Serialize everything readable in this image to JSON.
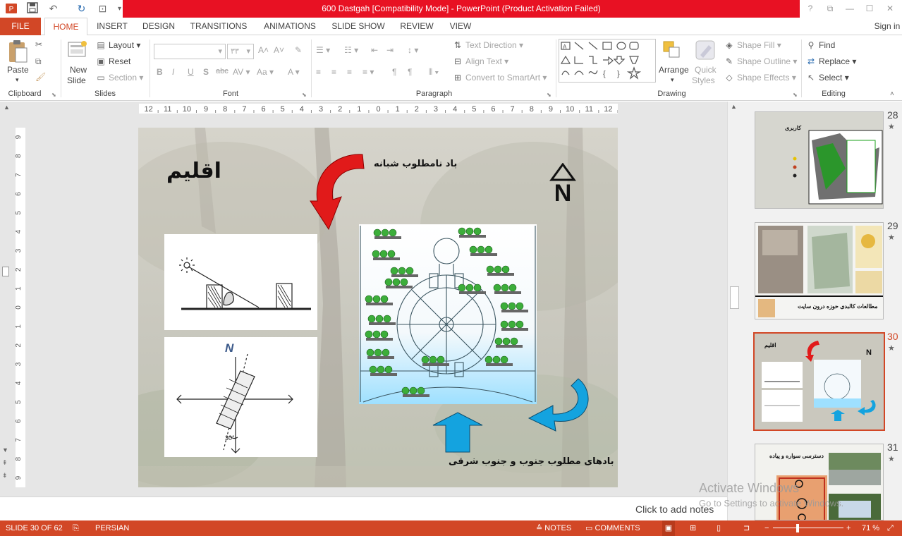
{
  "window": {
    "title": "600 Dastgah [Compatibility Mode] -  PowerPoint (Product Activation Failed)",
    "sign_in": "Sign in",
    "controls": [
      "?",
      "⧉",
      "—",
      "☐",
      "✕"
    ]
  },
  "tabs": [
    {
      "label": "FILE"
    },
    {
      "label": "HOME"
    },
    {
      "label": "INSERT"
    },
    {
      "label": "DESIGN"
    },
    {
      "label": "TRANSITIONS"
    },
    {
      "label": "ANIMATIONS"
    },
    {
      "label": "SLIDE SHOW"
    },
    {
      "label": "REVIEW"
    },
    {
      "label": "VIEW"
    }
  ],
  "ribbon": {
    "clipboard": {
      "label": "Clipboard",
      "paste": "Paste"
    },
    "slides": {
      "label": "Slides",
      "new_slide_1": "New",
      "new_slide_2": "Slide",
      "layout": "Layout",
      "reset": "Reset",
      "section": "Section"
    },
    "font": {
      "label": "Font",
      "size_value": "۳۳",
      "bold": "B",
      "italic": "I",
      "underline": "U",
      "shadow": "S",
      "strike": "abc",
      "spacing": "AV",
      "case": "Aa",
      "color": "A"
    },
    "paragraph": {
      "label": "Paragraph",
      "text_direction": "Text Direction",
      "align_text": "Align Text",
      "convert_smartart": "Convert to SmartArt"
    },
    "drawing": {
      "label": "Drawing",
      "arrange": "Arrange",
      "quick_styles_1": "Quick",
      "quick_styles_2": "Styles",
      "shape_fill": "Shape Fill",
      "shape_outline": "Shape Outline",
      "shape_effects": "Shape Effects"
    },
    "editing": {
      "label": "Editing",
      "find": "Find",
      "replace": "Replace",
      "select": "Select"
    }
  },
  "ruler": {
    "h_ticks": [
      "12",
      "11",
      "10",
      "9",
      "8",
      "7",
      "6",
      "5",
      "4",
      "3",
      "2",
      "1",
      "0",
      "1",
      "2",
      "3",
      "4",
      "5",
      "6",
      "7",
      "8",
      "9",
      "10",
      "11",
      "12"
    ],
    "v_ticks": [
      "9",
      "8",
      "7",
      "6",
      "5",
      "4",
      "3",
      "2",
      "1",
      "0",
      "1",
      "2",
      "3",
      "4",
      "5",
      "6",
      "7",
      "8",
      "9"
    ]
  },
  "slide": {
    "title": "اقلیم",
    "wind_bad": "باد نامطلوب شبانه",
    "wind_good": "بادهای مطلوب جنوب  و جنوب شرقی",
    "north": "N",
    "compass_north": "N",
    "angle": "30°"
  },
  "notes_placeholder": "Click to add notes",
  "thumbnails": [
    {
      "num": "28",
      "caption": "کاربری"
    },
    {
      "num": "29",
      "caption": "مطالعات کالبدی حوزه درون سایت"
    },
    {
      "num": "30",
      "caption": "اقلیم"
    },
    {
      "num": "31",
      "caption": "دسترسی سواره و پیاده"
    }
  ],
  "watermark": {
    "line1": "Activate Windows",
    "line2": "Go to Settings to activate Windows."
  },
  "status": {
    "slide_info": "SLIDE 30 OF 62",
    "language": "PERSIAN",
    "notes": "NOTES",
    "comments": "COMMENTS",
    "zoom": "71 %"
  }
}
